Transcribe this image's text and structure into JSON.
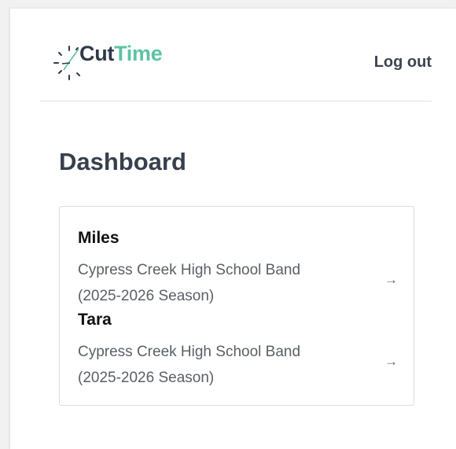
{
  "app": {
    "logo_part1": "Cut",
    "logo_part2": "Time",
    "logout_label": "Log out"
  },
  "colors": {
    "brand_dark": "#2f3a48",
    "brand_accent": "#5cc3a4"
  },
  "page": {
    "title": "Dashboard"
  },
  "members": [
    {
      "name": "Miles",
      "group": "Cypress Creek High School Band",
      "season": "(2025-2026 Season)",
      "arrow": "→"
    },
    {
      "name": "Tara",
      "group": "Cypress Creek High School Band",
      "season": "(2025-2026 Season)",
      "arrow": "→"
    }
  ]
}
